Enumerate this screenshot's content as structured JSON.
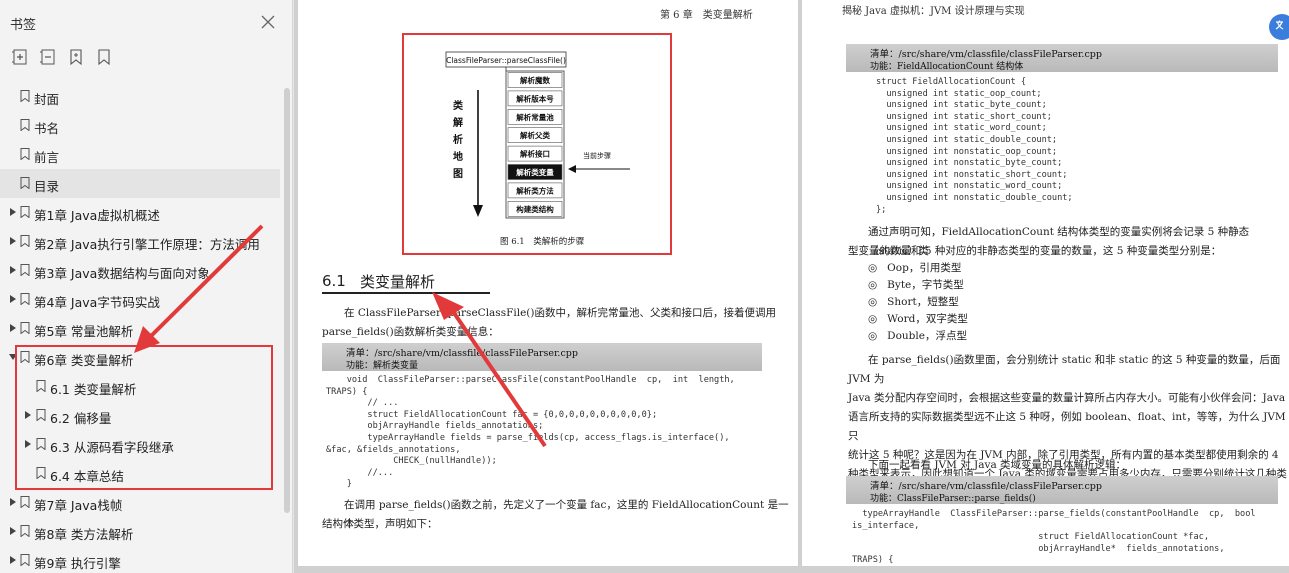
{
  "sidebar": {
    "title": "书签",
    "close_icon": "close-icon",
    "tools": [
      "expand-all-icon",
      "collapse-all-icon",
      "add-bookmark-icon",
      "bookmark-icon"
    ],
    "items": [
      {
        "label": "封面",
        "level": 0,
        "expandable": false,
        "active": false
      },
      {
        "label": "书名",
        "level": 0,
        "expandable": false,
        "active": false
      },
      {
        "label": "前言",
        "level": 0,
        "expandable": false,
        "active": false
      },
      {
        "label": "目录",
        "level": 0,
        "expandable": false,
        "active": true
      },
      {
        "label": "第1章 Java虚拟机概述",
        "level": 0,
        "expandable": true,
        "active": false
      },
      {
        "label": "第2章 Java执行引擎工作原理：方法调用",
        "level": 0,
        "expandable": true,
        "active": false
      },
      {
        "label": "第3章 Java数据结构与面向对象",
        "level": 0,
        "expandable": true,
        "active": false
      },
      {
        "label": "第4章 Java字节码实战",
        "level": 0,
        "expandable": true,
        "active": false
      },
      {
        "label": "第5章 常量池解析",
        "level": 0,
        "expandable": true,
        "active": false
      },
      {
        "label": "第6章 类变量解析",
        "level": 0,
        "expandable": true,
        "expanded": true,
        "active": false
      },
      {
        "label": "6.1 类变量解析",
        "level": 1,
        "expandable": false,
        "active": false
      },
      {
        "label": "6.2 偏移量",
        "level": 1,
        "expandable": true,
        "active": false
      },
      {
        "label": "6.3 从源码看字段继承",
        "level": 1,
        "expandable": true,
        "active": false
      },
      {
        "label": "6.4 本章总结",
        "level": 1,
        "expandable": false,
        "active": false
      },
      {
        "label": "第7章 Java栈帧",
        "level": 0,
        "expandable": true,
        "active": false
      },
      {
        "label": "第8章 类方法解析",
        "level": 0,
        "expandable": true,
        "active": false
      },
      {
        "label": "第9章 执行引擎",
        "level": 0,
        "expandable": true,
        "active": false
      }
    ]
  },
  "left_page": {
    "running_head": "第 6 章　类变量解析",
    "figure": {
      "top_label": "ClassFileParser::parseClassFile()",
      "side_label": [
        "类",
        "解",
        "析",
        "地",
        "图"
      ],
      "steps": [
        "解析魔数",
        "解析版本号",
        "解析常量池",
        "解析父类",
        "解析接口",
        "解析类变量",
        "解析类方法",
        "构建类结构"
      ],
      "current_index": 5,
      "current_label": "当前步骤",
      "caption": "图 6.1　类解析的步骤"
    },
    "section_num": "6.1",
    "section_title": "类变量解析",
    "para1_l1": "在 ClassFileParser::parseClassFile()函数中，解析完常量池、父类和接口后，接着便调用",
    "para1_l2": "parse_fields()函数解析类变量信息：",
    "listing_file": "清单：/src/share/vm/classfile/classFileParser.cpp",
    "listing_func": "功能：解析类变量",
    "code": "    void  ClassFileParser::parseClassFile(constantPoolHandle  cp,  int  length,\nTRAPS) {\n        // ...\n        struct FieldAllocationCount fac = {0,0,0,0,0,0,0,0,0,0};\n        objArrayHandle fields_annotations;\n        typeArrayHandle fields = parse_fields(cp, access_flags.is_interface(),\n&fac, &fields_annotations,\n             CHECK_(nullHandle));\n        //...\n    }",
    "para2_l1": "在调用 parse_fields()函数之前，先定义了一个变量 fac，这里的 FieldAllocationCount 是一个",
    "para2_l2": "结构体类型，声明如下："
  },
  "right_page": {
    "running_head": "揭秘 Java 虚拟机：JVM 设计原理与实现",
    "listing1_file": "清单：/src/share/vm/classfile/classFileParser.cpp",
    "listing1_func": "功能：FieldAllocationCount 结构体",
    "code1": "struct FieldAllocationCount {\n  unsigned int static_oop_count;\n  unsigned int static_byte_count;\n  unsigned int static_short_count;\n  unsigned int static_word_count;\n  unsigned int static_double_count;\n  unsigned int nonstatic_oop_count;\n  unsigned int nonstatic_byte_count;\n  unsigned int nonstatic_short_count;\n  unsigned int nonstatic_word_count;\n  unsigned int nonstatic_double_count;\n};",
    "para1_l1": "通过声明可知，FieldAllocationCount 结构体类型的变量实例将会记录 5 种静态（static）类",
    "para1_l2": "型变量的数量和 5 种对应的非静态类型的变量的数量，这 5 种变量类型分别是：",
    "bullets": [
      "Oop，引用类型",
      "Byte，字节类型",
      "Short，短整型",
      "Word，双字类型",
      "Double，浮点型"
    ],
    "para2": [
      "在 parse_fields()函数里面，会分别统计 static 和非 static 的这 5 种变量的数量，后面 JVM 为",
      "Java 类分配内存空间时，会根据这些变量的数量计算所占内存大小。可能有小伙伴会问：Java",
      "语言所支持的实际数据类型远不止这 5 种呀，例如 boolean、float、int，等等，为什么 JVM 只",
      "统计这 5 种呢？这是因为在 JVM 内部，除了引用类型，所有内置的基本类型都使用剩余的 4",
      "种类型来表示，因此想知道一个 Java 类的域变量需要占用多少内存，只需要分别统计这几种类",
      "型的数量即可。"
    ],
    "para3": "下面一起看看 JVM 对 Java 类域变量的具体解析逻辑：",
    "listing2_file": "清单：/src/share/vm/classfile/classFileParser.cpp",
    "listing2_func": "功能：ClassFileParser::parse_fields()",
    "code2": "  typeArrayHandle  ClassFileParser::parse_fields(constantPoolHandle  cp,  bool\nis_interface,\n                                    struct FieldAllocationCount *fac,\n                                    objArrayHandle*  fields_annotations,\nTRAPS) {"
  },
  "colors": {
    "highlight_red": "#e23a3a",
    "accent_blue": "#3b7ddd"
  },
  "fab_icon": "translate-icon"
}
